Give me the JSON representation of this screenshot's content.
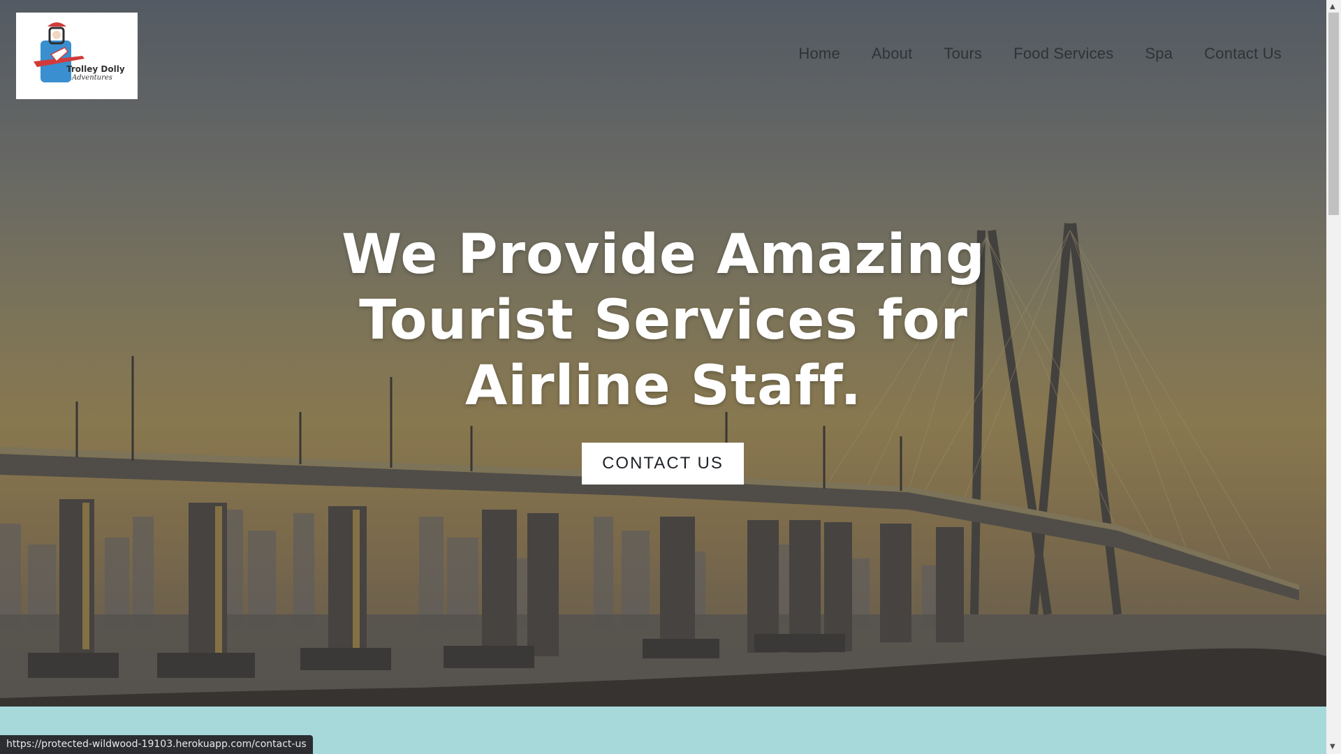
{
  "brand": {
    "logo_title": "Trolley Dolly",
    "logo_subtitle": "Adventures"
  },
  "nav": {
    "items": [
      {
        "label": "Home"
      },
      {
        "label": "About"
      },
      {
        "label": "Tours"
      },
      {
        "label": "Food Services"
      },
      {
        "label": "Spa"
      },
      {
        "label": "Contact Us"
      }
    ]
  },
  "hero": {
    "headline_line1": "We Provide Amazing",
    "headline_line2": "Tourist Services for",
    "headline_line3": "Airline Staff.",
    "cta_label": "CONTACT US",
    "background_image": "bridge-at-sunset"
  },
  "status_bar": {
    "url": "https://protected-wildwood-19103.herokuapp.com/contact-us"
  },
  "colors": {
    "band": "#a8d9da",
    "nav_text": "#303236",
    "headline": "#ffffff",
    "cta_bg": "#ffffff"
  }
}
